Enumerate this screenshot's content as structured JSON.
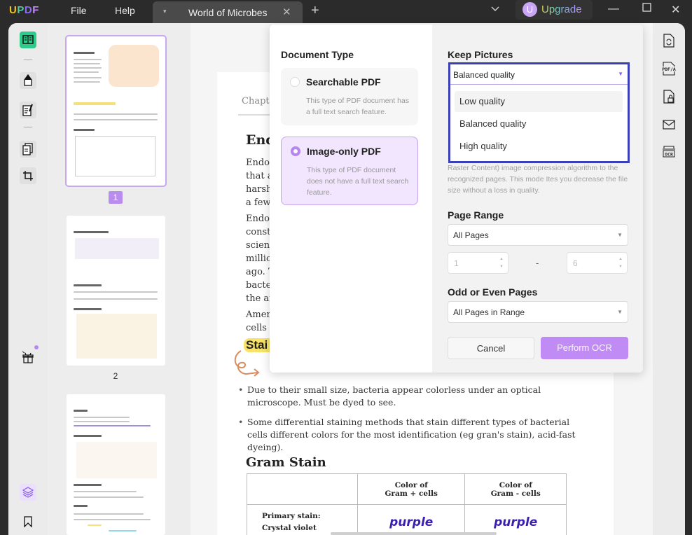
{
  "app": {
    "logo": [
      "U",
      "P",
      "D",
      "F"
    ],
    "menu": {
      "file": "File",
      "help": "Help"
    },
    "tab": {
      "title": "World of Microbes",
      "close": "✕",
      "dropdown": "▾"
    },
    "tab_add": "+",
    "tab_list": "⌄",
    "upgrade": {
      "avatar_letter": "U",
      "label": "Upgrade"
    },
    "window": {
      "minimize": "—",
      "maximize": "☐",
      "close": "✕"
    }
  },
  "thumbnails": {
    "pages": [
      {
        "label": "1",
        "selected": true
      },
      {
        "label": "2",
        "selected": false
      },
      {
        "label": "",
        "selected": false
      }
    ]
  },
  "document": {
    "chapter": "Chapte",
    "heading1": "End",
    "lines": [
      "Endos",
      "that a",
      "harsh",
      "a few",
      "Endos",
      "constr",
      "scient",
      "millio",
      "ago. T",
      "bacter",
      "the an",
      "Ameri",
      "cells i"
    ],
    "heading2": "Stai",
    "bullets": [
      "Due to their small size, bacteria appear colorless under an optical microscope. Must be dyed to see.",
      "Some differential staining methods that stain different types of bacterial cells different colors for the most identification (eg gran's stain), acid-fast dyeing)."
    ],
    "gram_heading": "Gram Stain",
    "table": {
      "headers": [
        "",
        "Color of\nGram + cells",
        "Color of\nGram - cells"
      ],
      "header_plus_l1": "Color of",
      "header_plus_l2": "Gram + cells",
      "header_minus_l1": "Color of",
      "header_minus_l2": "Gram - cells",
      "rows": [
        {
          "label_l1": "Primary stain:",
          "label_l2": "Crystal violet",
          "plus": "purple",
          "minus": "purple"
        }
      ]
    }
  },
  "ocr_dialog": {
    "document_type": {
      "title": "Document Type",
      "options": [
        {
          "title": "Searchable PDF",
          "desc": "This type of PDF document has a full text search feature.",
          "selected": false
        },
        {
          "title": "Image-only PDF",
          "desc": "This type of PDF document does not have a full text search feature.",
          "selected": true
        }
      ]
    },
    "keep_pictures": {
      "title": "Keep Pictures",
      "value": "Balanced quality",
      "options": [
        "Low quality",
        "Balanced quality",
        "High quality"
      ],
      "hovered": "Low quality",
      "desc": "Raster Content) image compression algorithm to the recognized pages. This mode Ites you decrease the file size without a loss in quality."
    },
    "page_range": {
      "title": "Page Range",
      "value": "All Pages",
      "from": "1",
      "to": "6",
      "separator": "-"
    },
    "odd_even": {
      "title": "Odd or Even Pages",
      "value": "All Pages in Range"
    },
    "buttons": {
      "cancel": "Cancel",
      "perform": "Perform OCR"
    }
  },
  "colors": {
    "accent": "#b98cf0",
    "active_tool": "#2ecc8a",
    "dropdown_focus": "#3b3fb8",
    "highlight": "#f8e36a"
  }
}
